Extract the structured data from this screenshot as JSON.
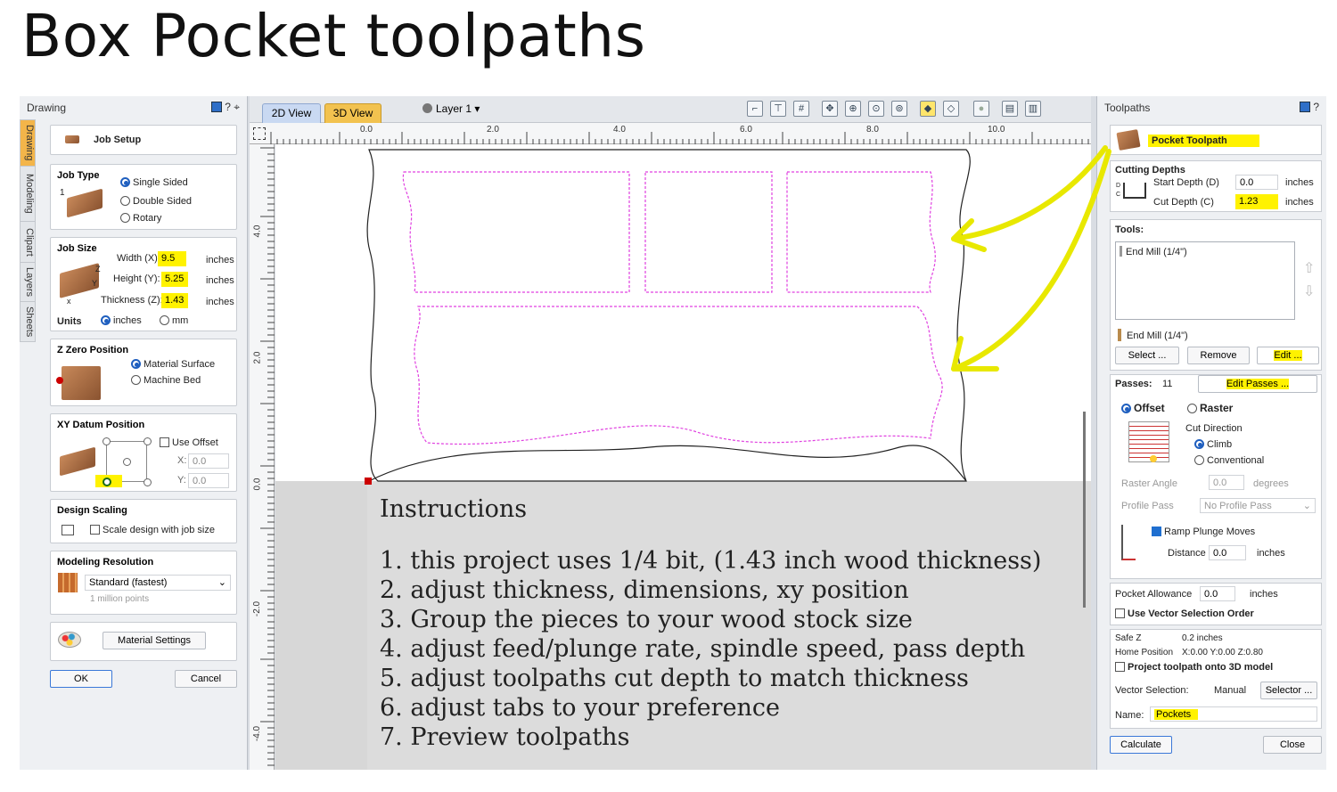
{
  "slide_title": "Box Pocket toolpaths",
  "left": {
    "header": "Drawing",
    "header_icons": "? ⌖",
    "side_tabs": [
      "Drawing",
      "Modeling",
      "Clipart",
      "Layers",
      "Sheets"
    ],
    "job_setup": "Job Setup",
    "job_type": {
      "title": "Job Type",
      "options": [
        "Single Sided",
        "Double Sided",
        "Rotary"
      ],
      "selected": "Single Sided",
      "icon_num": "1"
    },
    "job_size": {
      "title": "Job Size",
      "width_label": "Width (X):",
      "width": "9.5",
      "height_label": "Height (Y):",
      "height": "5.25",
      "thickness_label": "Thickness (Z):",
      "thickness": "1.43",
      "unit": "inches",
      "units_label": "Units",
      "unit_inches": "inches",
      "unit_mm": "mm",
      "axis_x": "x",
      "axis_y": "Y",
      "axis_z": "Z"
    },
    "z_zero": {
      "title": "Z Zero Position",
      "options": [
        "Material Surface",
        "Machine Bed"
      ]
    },
    "xy_datum": {
      "title": "XY Datum Position",
      "use_offset": "Use Offset",
      "x_label": "X:",
      "x": "0.0",
      "y_label": "Y:",
      "y": "0.0"
    },
    "design_scaling": {
      "title": "Design Scaling",
      "scale_label": "Scale design with job size"
    },
    "modeling_res": {
      "title": "Modeling Resolution",
      "value": "Standard (fastest)",
      "sub": "1 million points"
    },
    "material_settings": "Material Settings",
    "ok": "OK",
    "cancel": "Cancel"
  },
  "toolbar": {
    "tab_2d": "2D View",
    "tab_3d": "3D View",
    "layer": "Layer 1 ▾"
  },
  "ruler": {
    "top": [
      "0.0",
      "2.0",
      "4.0",
      "6.0",
      "8.0",
      "10.0"
    ],
    "left": [
      "4.0",
      "2.0",
      "0.0",
      "-2.0",
      "-4.0"
    ]
  },
  "instructions": {
    "heading": "Instructions",
    "lines": [
      "1. this project uses 1/4 bit, (1.43 inch wood thickness)",
      "2. adjust thickness, dimensions, xy position",
      "3. Group the pieces to your wood stock size",
      "4. adjust feed/plunge rate, spindle speed, pass depth",
      "5. adjust toolpaths cut depth to match thickness",
      "6. adjust tabs to your preference",
      "7. Preview toolpaths"
    ]
  },
  "right": {
    "header": "Toolpaths",
    "header_icons": "?",
    "toolpath_name": "Pocket Toolpath",
    "cutting_depths": {
      "title": "Cutting Depths",
      "start_label": "Start Depth (D)",
      "start": "0.0",
      "cut_label": "Cut Depth (C)",
      "cut": "1.23",
      "unit": "inches",
      "icon_d": "D",
      "icon_c": "C"
    },
    "tools": {
      "title": "Tools:",
      "list_item": "End Mill (1/4\")",
      "selected": "End Mill (1/4\")",
      "select": "Select ...",
      "remove": "Remove",
      "edit": "Edit ..."
    },
    "passes": {
      "label": "Passes:",
      "value": "11",
      "edit": "Edit Passes ..."
    },
    "strategy": {
      "offset": "Offset",
      "raster": "Raster",
      "cut_direction": "Cut Direction",
      "climb": "Climb",
      "conventional": "Conventional"
    },
    "raster_angle": {
      "label": "Raster Angle",
      "value": "0.0",
      "unit": "degrees"
    },
    "profile_pass": {
      "label": "Profile Pass",
      "value": "No Profile Pass"
    },
    "ramp": {
      "label": "Ramp Plunge Moves",
      "distance_label": "Distance",
      "distance": "0.0",
      "unit": "inches"
    },
    "pocket_allowance": {
      "label": "Pocket Allowance",
      "value": "0.0",
      "unit": "inches"
    },
    "vector_order": "Use Vector Selection Order",
    "safe_z": {
      "label": "Safe Z",
      "value": "0.2 inches"
    },
    "home": {
      "label": "Home Position",
      "value": "X:0.00 Y:0.00 Z:0.80"
    },
    "project_3d": "Project toolpath onto 3D model",
    "vector_selection": {
      "label": "Vector Selection:",
      "value": "Manual",
      "button": "Selector ..."
    },
    "name": {
      "label": "Name:",
      "value": "Pockets"
    },
    "calculate": "Calculate",
    "close": "Close"
  },
  "colors": {
    "highlight": "#fff200",
    "accent": "#1f5fbf",
    "pocket_line": "#e040e0",
    "annotation": "#e8e800"
  }
}
